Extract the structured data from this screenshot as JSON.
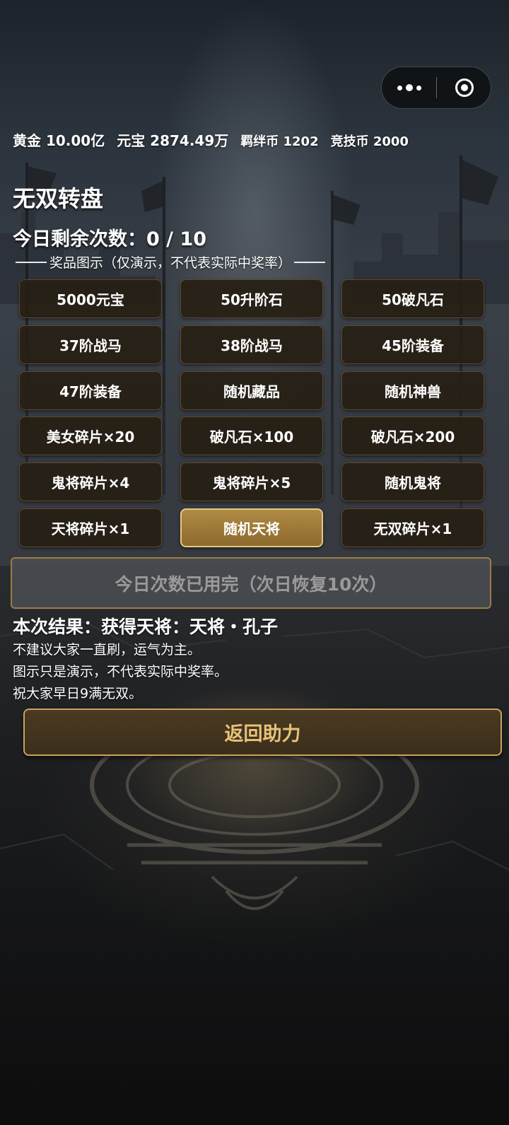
{
  "currency": {
    "gold": "黄金 10.00亿",
    "yuanbao": "元宝 2874.49万",
    "jiban": "羁绊币 1202",
    "jingji": "竞技币 2000"
  },
  "title": "无双转盘",
  "remaining": "今日剩余次数：0 / 10",
  "legend": "奖品图示（仅演示，不代表实际中奖率）",
  "prizes": [
    "5000元宝",
    "50升阶石",
    "50破凡石",
    "37阶战马",
    "38阶战马",
    "45阶装备",
    "47阶装备",
    "随机藏品",
    "随机神兽",
    "美女碎片×20",
    "破凡石×100",
    "破凡石×200",
    "鬼将碎片×4",
    "鬼将碎片×5",
    "随机鬼将",
    "天将碎片×1",
    "随机天将",
    "无双碎片×1"
  ],
  "active_prize": "随机天将",
  "spin_button": "今日次数已用完（次日恢复10次）",
  "result": "本次结果：获得天将：天将・孔子",
  "notes": [
    "不建议大家一直刷，运气为主。",
    "图示只是演示，不代表实际中奖率。",
    "祝大家早日9满无双。"
  ],
  "back_button": "返回助力",
  "colors": {
    "accent_gold": "#c7a35e",
    "active_cell": "#b08a45",
    "back_text": "#e8c27a",
    "disabled_text": "#9a9a9a"
  },
  "icons": {
    "menu": "more-dots-icon",
    "close": "close-target-icon"
  }
}
